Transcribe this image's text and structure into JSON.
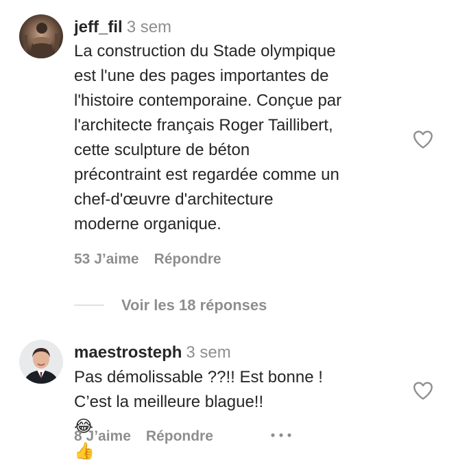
{
  "comments": [
    {
      "username": "jeff_fil",
      "time": "3 sem",
      "lines": [
        "La construction du Stade olympique",
        "est l'une des pages importantes de",
        "l'histoire contemporaine. Conçue par",
        "l'architecte français Roger Taillibert,",
        "cette sculpture de béton",
        "précontraint est regardée comme un",
        "chef-d'œuvre d'architecture",
        "moderne organique."
      ],
      "likes": "53 J’aime",
      "reply": "Répondre",
      "avatar_icon": "user-avatar-photo-icon",
      "like_icon": "heart-outline-icon"
    },
    {
      "username": "maestrosteph",
      "time": "3 sem",
      "lines": [
        "Pas démolissable ??!! Est bonne !",
        "C’est la meilleure blague!!"
      ],
      "emojis": [
        "😂",
        "👍"
      ],
      "likes": "8 J’aime",
      "reply": "Répondre",
      "avatar_icon": "user-avatar-photo-icon",
      "like_icon": "heart-outline-icon",
      "more_icon": "more-options-icon"
    }
  ],
  "view_replies": "Voir les 18 réponses",
  "colors": {
    "text": "#262626",
    "secondary": "#8e8e8e",
    "divider": "#c7c7c7",
    "background": "#ffffff"
  }
}
